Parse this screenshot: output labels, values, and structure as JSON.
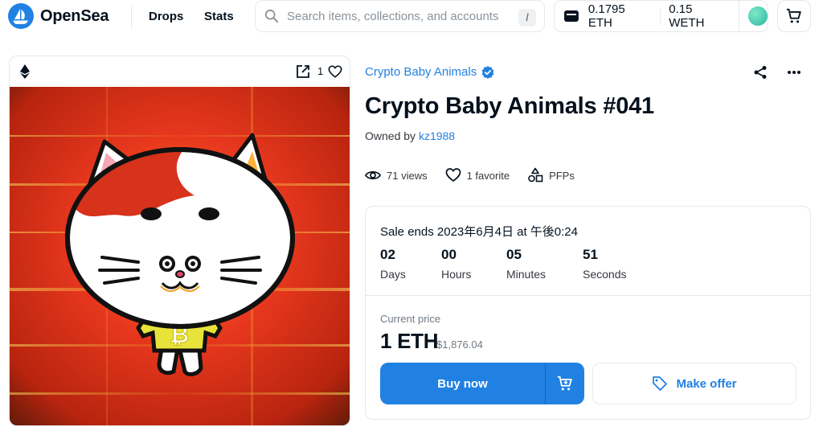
{
  "header": {
    "logo_text": "OpenSea",
    "nav": [
      "Drops",
      "Stats"
    ],
    "search_placeholder": "Search items, collections, and accounts",
    "search_shortcut": "/",
    "wallet_eth": "0.1795 ETH",
    "wallet_weth": "0.15 WETH"
  },
  "card": {
    "favorite_count": "1"
  },
  "item": {
    "collection": "Crypto Baby Animals",
    "title": "Crypto Baby Animals #041",
    "owned_prefix": "Owned by",
    "owner": "kz1988",
    "views": "71 views",
    "favorites": "1 favorite",
    "category": "PFPs"
  },
  "sale": {
    "ends_text": "Sale ends 2023年6月4日 at 午後0:24",
    "countdown": [
      {
        "value": "02",
        "label": "Days"
      },
      {
        "value": "00",
        "label": "Hours"
      },
      {
        "value": "05",
        "label": "Minutes"
      },
      {
        "value": "51",
        "label": "Seconds"
      }
    ],
    "price_label": "Current price",
    "price_eth": "1 ETH",
    "price_usd": "$1,876.04",
    "buy_label": "Buy now",
    "offer_label": "Make offer"
  },
  "colors": {
    "accent": "#2081e2",
    "text": "#04111d",
    "border": "#e5e8eb"
  }
}
